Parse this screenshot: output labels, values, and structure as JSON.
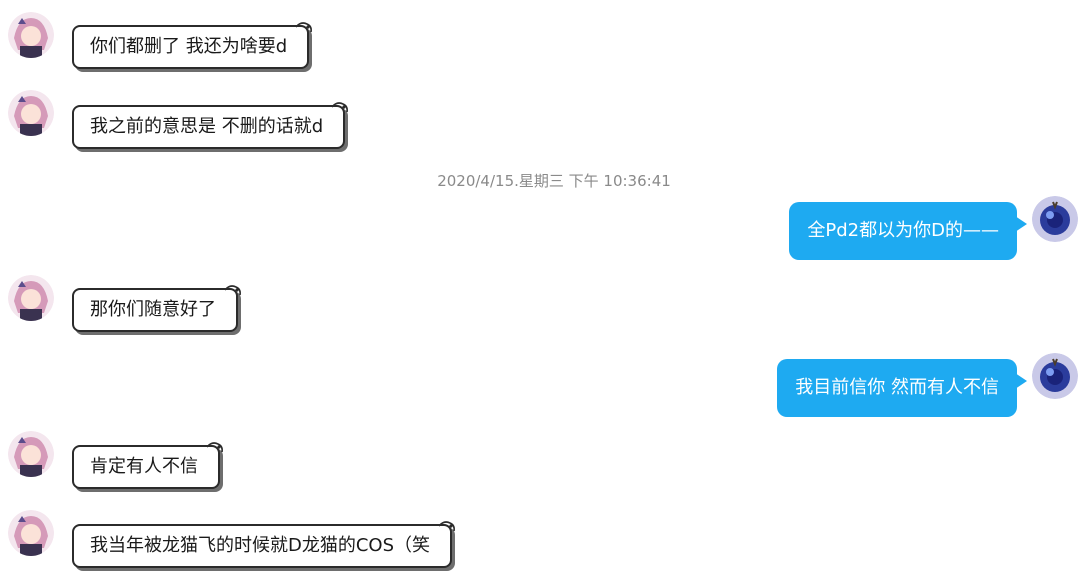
{
  "timestamp": "2020/4/15.星期三 下午 10:36:41",
  "messages": [
    {
      "side": "left",
      "text": "你们都删了 我还为啥要d"
    },
    {
      "side": "left",
      "text": "我之前的意思是 不删的话就d"
    },
    {
      "side": "right",
      "text": "全Pd2都以为你D的——"
    },
    {
      "side": "left",
      "text": "那你们随意好了"
    },
    {
      "side": "right",
      "text": "我目前信你 然而有人不信"
    },
    {
      "side": "left",
      "text": "肯定有人不信"
    },
    {
      "side": "left",
      "text": "我当年被龙猫飞的时候就D龙猫的COS（笑"
    }
  ],
  "colors": {
    "right_bubble": "#1eaaf1",
    "left_border": "#2b2b2b",
    "timestamp_text": "#8a8a8a"
  },
  "icons": {
    "left_avatar": "anime-girl-avatar",
    "right_avatar": "blue-orb-avatar",
    "bubble_decoration": "page-curl-icon"
  }
}
